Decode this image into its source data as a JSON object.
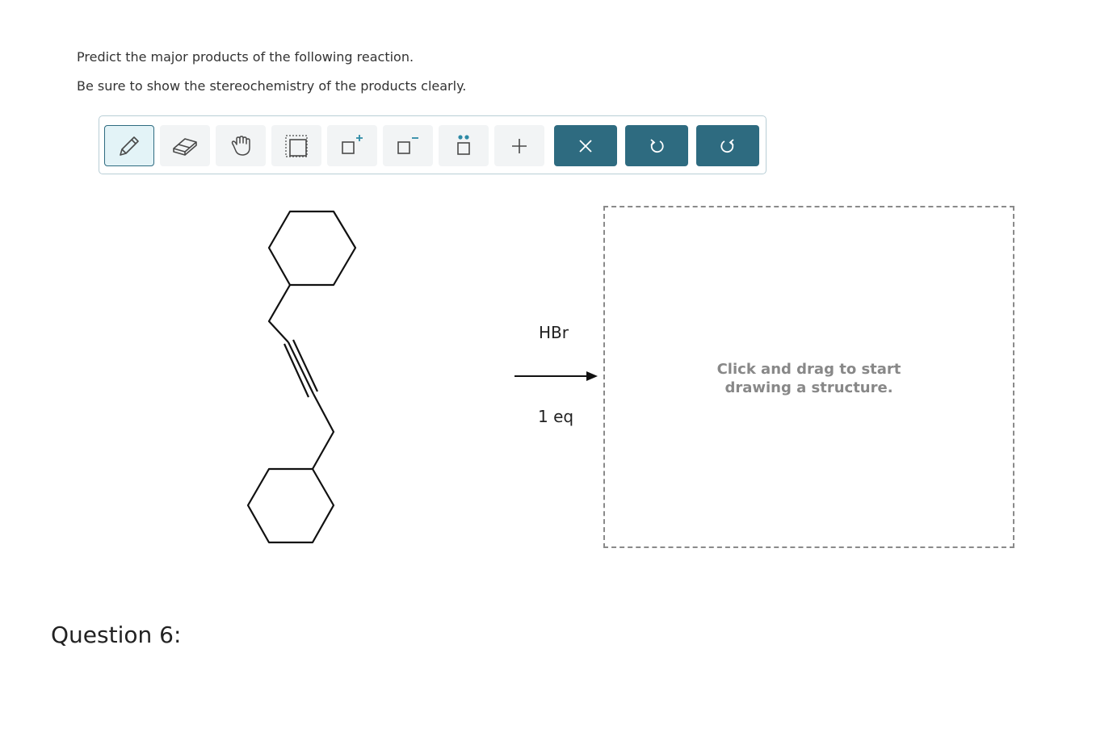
{
  "prompt": {
    "line1": "Predict the major products of the following reaction.",
    "line2": "Be sure to show the stereochemistry of the products clearly."
  },
  "toolbar": {
    "tools": [
      {
        "name": "pencil-icon",
        "active": true
      },
      {
        "name": "eraser-icon",
        "active": false
      },
      {
        "name": "hand-icon",
        "active": false
      },
      {
        "name": "select-icon",
        "active": false
      },
      {
        "name": "positive-charge-icon",
        "active": false
      },
      {
        "name": "negative-charge-icon",
        "active": false
      },
      {
        "name": "lone-pair-icon",
        "active": false
      },
      {
        "name": "plus-icon",
        "active": false
      }
    ],
    "actions": [
      "clear-icon",
      "undo-icon",
      "redo-icon"
    ],
    "accent": "#2e6b80"
  },
  "reaction": {
    "reagent": "HBr",
    "condition": "1 eq"
  },
  "drawing_area": {
    "placeholder": "Click and drag to start\ndrawing a structure."
  },
  "question_label": "Question 6:"
}
